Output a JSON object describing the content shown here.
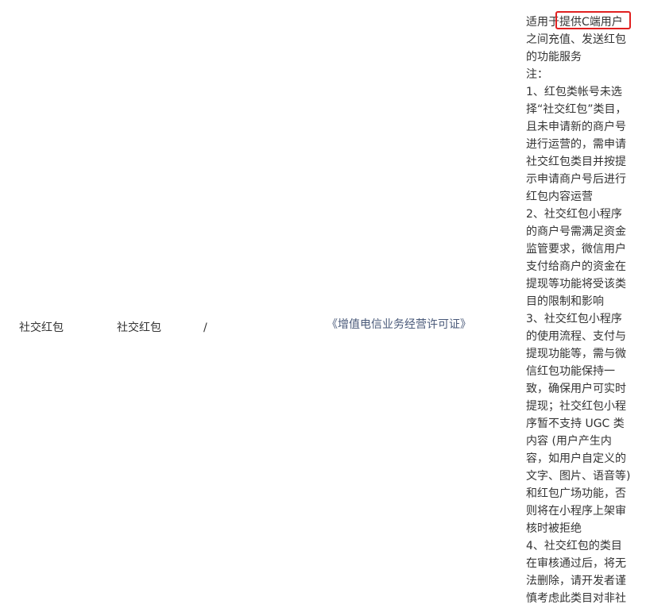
{
  "row": {
    "category_level1": "社交红包",
    "category_level2": "社交红包",
    "qualification": "/",
    "license": "《增值电信业务经营许可证》",
    "description_lines": [
      "适用于提供C端用户",
      "之间充值、发送红包",
      "的功能服务",
      "注：",
      "1、红包类帐号未选",
      "择“社交红包”类目，",
      "且未申请新的商户号",
      "进行运营的，需申请",
      "社交红包类目并按提",
      "示申请商户号后进行",
      "红包内容运营",
      "2、社交红包小程序",
      "的商户号需满足资金",
      "监管要求，微信用户",
      "支付给商户的资金在",
      "提现等功能将受该类",
      "目的限制和影响",
      "3、社交红包小程序",
      "的使用流程、支付与",
      "提现功能等，需与微",
      "信红包功能保持一",
      "致，确保用户可实时",
      "提现；社交红包小程",
      "序暂不支持 UGC 类",
      "内容 (用户产生内",
      "容，如用户自定义的",
      "文字、图片、语音等)",
      "和红包广场功能，否",
      "则将在小程序上架审",
      "核时被拒绝",
      "4、社交红包的类目",
      "在审核通过后，将无",
      "法删除，请开发者谨",
      "慎考虑此类目对非社"
    ]
  },
  "highlight": {
    "color": "#e02020"
  }
}
